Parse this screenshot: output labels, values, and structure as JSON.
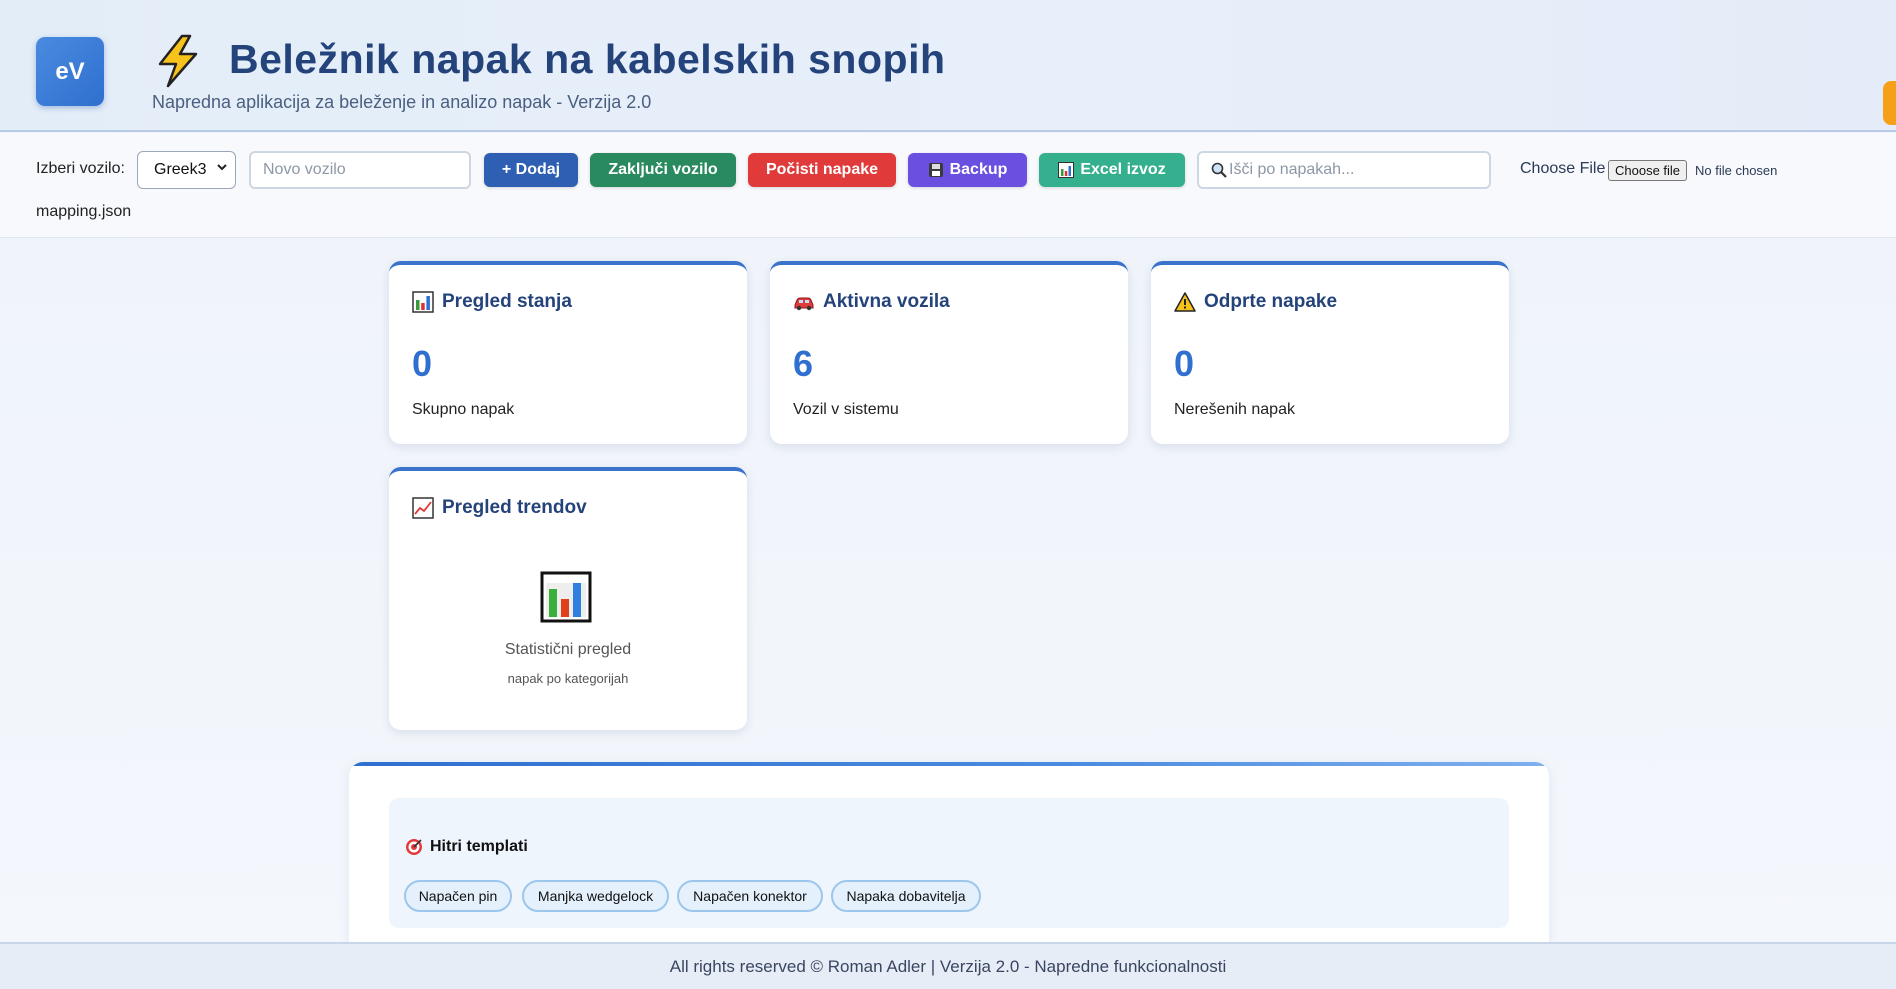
{
  "header": {
    "logo_text": "eV",
    "title": "Beležnik napak na kabelskih snopih",
    "subtitle": "Napredna aplikacija za beleženje in analizo napak - Verzija 2.0",
    "icon": "lightning-icon"
  },
  "toolbar": {
    "vehicle_label": "Izberi vozilo:",
    "vehicle_selected": "Greek3",
    "new_vehicle_placeholder": "Novo vozilo",
    "add_label": "+ Dodaj",
    "close_vehicle_label": "Zaključi vozilo",
    "clear_label": "Počisti napake",
    "backup_label": "Backup",
    "excel_label": "Excel izvoz",
    "search_placeholder": "Išči po napakah...",
    "file_label": "Choose File",
    "file_button": "Choose file",
    "file_status": "No file chosen",
    "mapping_text": "mapping.json",
    "colors": {
      "add": "#2f5fb3",
      "close": "#2a8a5f",
      "clear": "#e03a3a",
      "backup": "#6a4fe0",
      "excel": "#35b08e"
    }
  },
  "cards": [
    {
      "title": "Pregled stanja",
      "value": "0",
      "desc": "Skupno napak",
      "icon": "bar-chart-icon"
    },
    {
      "title": "Aktivna vozila",
      "value": "6",
      "desc": "Vozil v sistemu",
      "icon": "car-icon"
    },
    {
      "title": "Odprte napake",
      "value": "0",
      "desc": "Nerešenih napak",
      "icon": "warning-icon"
    }
  ],
  "trend_card": {
    "title": "Pregled trendov",
    "icon": "trend-chart-icon",
    "line1": "Statistični pregled",
    "line2": "napak po kategorijah"
  },
  "templates": {
    "title": "Hitri templati",
    "icon": "target-icon",
    "chips": [
      "Napačen pin",
      "Manjka wedgelock",
      "Napačen konektor",
      "Napaka dobavitelja"
    ]
  },
  "footer": {
    "text": "All rights reserved © Roman Adler | Verzija 2.0 - Napredne funkcionalnosti"
  }
}
